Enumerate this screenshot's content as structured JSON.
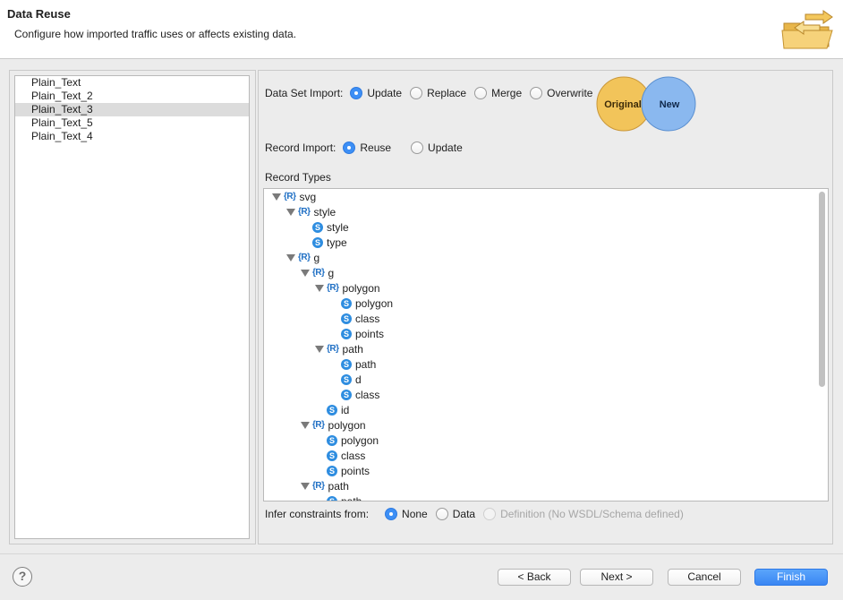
{
  "header": {
    "title": "Data Reuse",
    "description": "Configure how imported traffic uses or affects existing data."
  },
  "left_list": {
    "items": [
      "Plain_Text",
      "Plain_Text_2",
      "Plain_Text_3",
      "Plain_Text_5",
      "Plain_Text_4"
    ],
    "selected_index": 2
  },
  "data_set_import": {
    "label": "Data Set Import:",
    "options": [
      "Update",
      "Replace",
      "Merge",
      "Overwrite"
    ],
    "selected": "Update"
  },
  "venn": {
    "left": "Original",
    "right": "New"
  },
  "record_import": {
    "label": "Record Import:",
    "options": [
      "Reuse",
      "Update"
    ],
    "selected": "Reuse"
  },
  "record_types": {
    "label": "Record Types",
    "tree": [
      {
        "kind": "record",
        "label": "svg",
        "depth": 0,
        "expanded": true
      },
      {
        "kind": "record",
        "label": "style",
        "depth": 1,
        "expanded": true
      },
      {
        "kind": "string",
        "label": "style",
        "depth": 2
      },
      {
        "kind": "string",
        "label": "type",
        "depth": 2
      },
      {
        "kind": "record",
        "label": "g",
        "depth": 1,
        "expanded": true
      },
      {
        "kind": "record",
        "label": "g",
        "depth": 2,
        "expanded": true
      },
      {
        "kind": "record",
        "label": "polygon",
        "depth": 3,
        "expanded": true
      },
      {
        "kind": "string",
        "label": "polygon",
        "depth": 4
      },
      {
        "kind": "string",
        "label": "class",
        "depth": 4
      },
      {
        "kind": "string",
        "label": "points",
        "depth": 4
      },
      {
        "kind": "record",
        "label": "path",
        "depth": 3,
        "expanded": true
      },
      {
        "kind": "string",
        "label": "path",
        "depth": 4
      },
      {
        "kind": "string",
        "label": "d",
        "depth": 4
      },
      {
        "kind": "string",
        "label": "class",
        "depth": 4
      },
      {
        "kind": "string",
        "label": "id",
        "depth": 3
      },
      {
        "kind": "record",
        "label": "polygon",
        "depth": 2,
        "expanded": true
      },
      {
        "kind": "string",
        "label": "polygon",
        "depth": 3
      },
      {
        "kind": "string",
        "label": "class",
        "depth": 3
      },
      {
        "kind": "string",
        "label": "points",
        "depth": 3
      },
      {
        "kind": "record",
        "label": "path",
        "depth": 2,
        "expanded": true
      },
      {
        "kind": "string",
        "label": "path",
        "depth": 3
      }
    ],
    "record_icon": "{R}",
    "string_icon": "S"
  },
  "infer": {
    "label": "Infer constraints from:",
    "options": [
      "None",
      "Data",
      "Definition (No WSDL/Schema defined)"
    ],
    "selected": "None",
    "disabled": [
      "Definition (No WSDL/Schema defined)"
    ]
  },
  "buttons": {
    "help": "?",
    "back": "< Back",
    "next": "Next >",
    "cancel": "Cancel",
    "finish": "Finish"
  },
  "colors": {
    "accent": "#3d8ff5",
    "original_circle": "#f2c45a",
    "new_circle": "#8ab8ef"
  }
}
